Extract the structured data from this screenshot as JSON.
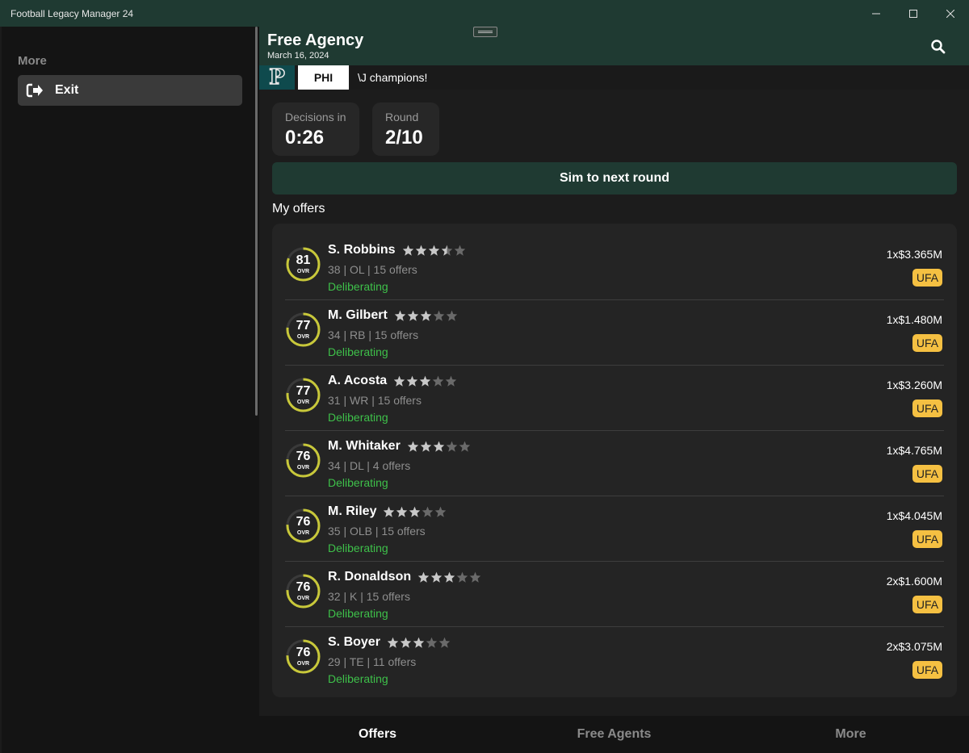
{
  "window": {
    "title": "Football Legacy Manager 24"
  },
  "sidebar": {
    "section_label": "More",
    "exit_label": "Exit"
  },
  "header": {
    "title": "Free Agency",
    "date": "March 16, 2024"
  },
  "ticker": {
    "team_abbr": "PHI",
    "logo_letter": "P",
    "news": "\\J champions!"
  },
  "stats": {
    "decisions": {
      "label": "Decisions in",
      "value": "0:26"
    },
    "round": {
      "label": "Round",
      "value": "2/10"
    }
  },
  "sim_button": "Sim to next round",
  "offers_label": "My offers",
  "ovr_label": "OVR",
  "colors": {
    "accent": "#1f3a32",
    "ring": "#c8c83a",
    "status": "#3ec04a",
    "badge": "#f5c042"
  },
  "offers": [
    {
      "ovr": "81",
      "name": "S. Robbins",
      "stars": 3.5,
      "meta": "38 | OL | 15 offers",
      "status": "Deliberating",
      "contract": "1x$3.365M",
      "badge": "UFA"
    },
    {
      "ovr": "77",
      "name": "M. Gilbert",
      "stars": 3,
      "meta": "34 | RB | 15 offers",
      "status": "Deliberating",
      "contract": "1x$1.480M",
      "badge": "UFA"
    },
    {
      "ovr": "77",
      "name": "A. Acosta",
      "stars": 3,
      "meta": "31 | WR | 15 offers",
      "status": "Deliberating",
      "contract": "1x$3.260M",
      "badge": "UFA"
    },
    {
      "ovr": "76",
      "name": "M. Whitaker",
      "stars": 3,
      "meta": "34 | DL | 4 offers",
      "status": "Deliberating",
      "contract": "1x$4.765M",
      "badge": "UFA"
    },
    {
      "ovr": "76",
      "name": "M. Riley",
      "stars": 3,
      "meta": "35 | OLB | 15 offers",
      "status": "Deliberating",
      "contract": "1x$4.045M",
      "badge": "UFA"
    },
    {
      "ovr": "76",
      "name": "R. Donaldson",
      "stars": 3,
      "meta": "32 | K | 15 offers",
      "status": "Deliberating",
      "contract": "2x$1.600M",
      "badge": "UFA"
    },
    {
      "ovr": "76",
      "name": "S. Boyer",
      "stars": 3,
      "meta": "29 | TE | 11 offers",
      "status": "Deliberating",
      "contract": "2x$3.075M",
      "badge": "UFA"
    }
  ],
  "tabs": [
    {
      "label": "Offers",
      "active": true
    },
    {
      "label": "Free Agents",
      "active": false
    },
    {
      "label": "More",
      "active": false
    }
  ]
}
